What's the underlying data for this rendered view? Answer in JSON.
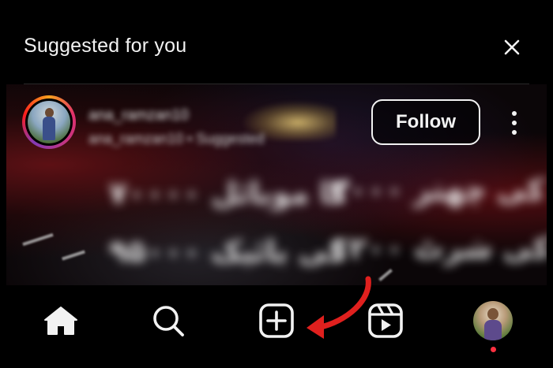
{
  "header": {
    "title": "Suggested for you",
    "close_icon": "close-icon"
  },
  "suggestion": {
    "username": "ana_ramzan10",
    "subline": "ana_ramzan10 • Suggested",
    "follow_label": "Follow",
    "more_icon": "more-vertical-icon"
  },
  "post": {
    "text_lines": [
      "۲۰۰۰ کی چھتر",
      "۷۰۰۰۰ کا موبائل",
      "۱۲۰۰ کی شرٹ",
      "۹۵۰۰۰ کی بائیک"
    ]
  },
  "nav": {
    "items": [
      {
        "name": "home",
        "icon": "home-icon"
      },
      {
        "name": "search",
        "icon": "search-icon"
      },
      {
        "name": "create",
        "icon": "plus-square-icon"
      },
      {
        "name": "reels",
        "icon": "reels-icon"
      },
      {
        "name": "profile",
        "icon": "avatar"
      }
    ],
    "notification_color": "#ff3040"
  },
  "annotation": {
    "arrow_color": "#e0201e",
    "points_to": "create"
  }
}
